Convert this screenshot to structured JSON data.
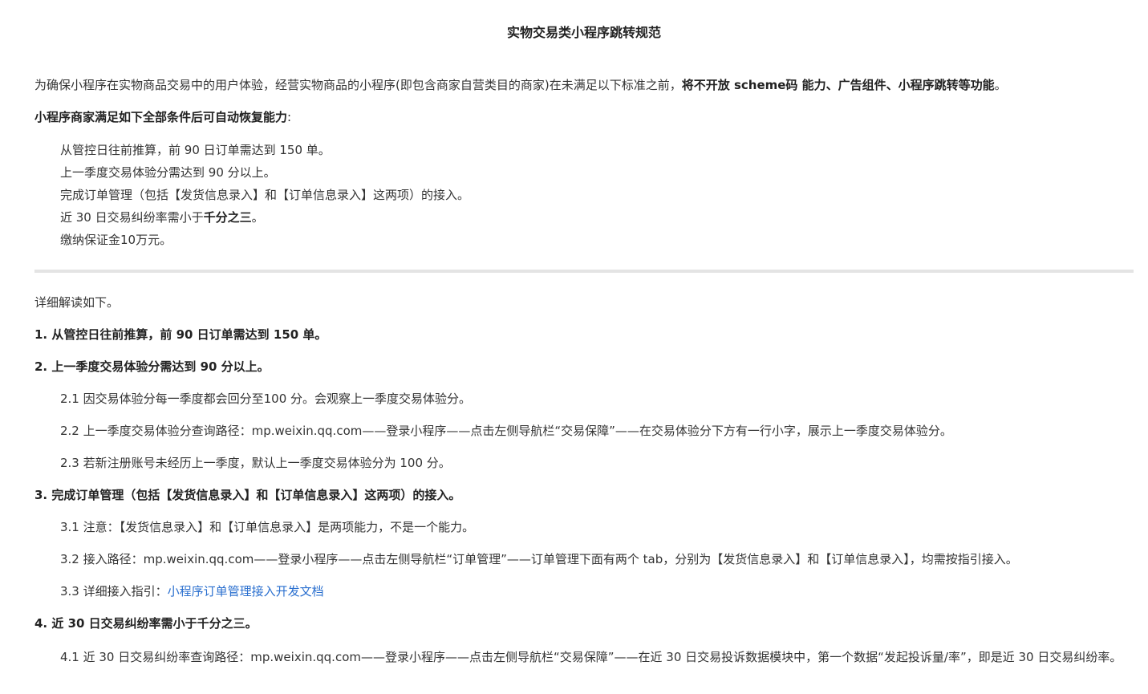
{
  "doc": {
    "title": "实物交易类小程序跳转规范",
    "intro_pre": "为确保小程序在实物商品交易中的用户体验，经营实物商品的小程序(即包含商家自营类目的商家)在未满足以下标准之前，",
    "intro_bold": "将不开放 scheme码 能力、广告组件、小程序跳转等功能",
    "intro_post": "。",
    "conditions_heading": "小程序商家满足如下全部条件后可自动恢复能力",
    "conditions_heading_colon": ":",
    "conditions": [
      "从管控日往前推算，前 90 日订单需达到 150 单。",
      "上一季度交易体验分需达到 90 分以上。",
      "完成订单管理（包括【发货信息录入】和【订单信息录入】这两项）的接入。"
    ],
    "condition4_pre": "近 30 日交易纠纷率需小于",
    "condition4_bold": "千分之三",
    "condition4_post": "。",
    "condition5": "缴纳保证金10万元。",
    "detail_heading": "详细解读如下。",
    "section1": "1. 从管控日往前推算，前 90 日订单需达到 150 单。",
    "section2": "2. 上一季度交易体验分需达到 90 分以上。",
    "s2_1": "2.1 因交易体验分每一季度都会回分至100 分。会观察上一季度交易体验分。",
    "s2_2": "2.2 上一季度交易体验分查询路径：mp.weixin.qq.com——登录小程序——点击左侧导航栏“交易保障”——在交易体验分下方有一行小字，展示上一季度交易体验分。",
    "s2_3": "2.3 若新注册账号未经历上一季度，默认上一季度交易体验分为 100 分。",
    "section3": "3. 完成订单管理（包括【发货信息录入】和【订单信息录入】这两项）的接入。",
    "s3_1": "3.1 注意：【发货信息录入】和【订单信息录入】是两项能力，不是一个能力。",
    "s3_2": "3.2 接入路径：mp.weixin.qq.com——登录小程序——点击左侧导航栏“订单管理”——订单管理下面有两个 tab，分别为【发货信息录入】和【订单信息录入】，均需按指引接入。",
    "s3_3_pre": "3.3 详细接入指引：",
    "s3_3_link": "小程序订单管理接入开发文档",
    "section4": "4. 近 30 日交易纠纷率需小于千分之三。",
    "s4_1": "4.1 近 30 日交易纠纷率查询路径：mp.weixin.qq.com——登录小程序——点击左侧导航栏“交易保障”——在近 30 日交易投诉数据模块中，第一个数据“发起投诉量/率”，即是近 30 日交易纠纷率。",
    "link_color": "#2a6fcf",
    "divider_color": "#e4e4e4"
  }
}
